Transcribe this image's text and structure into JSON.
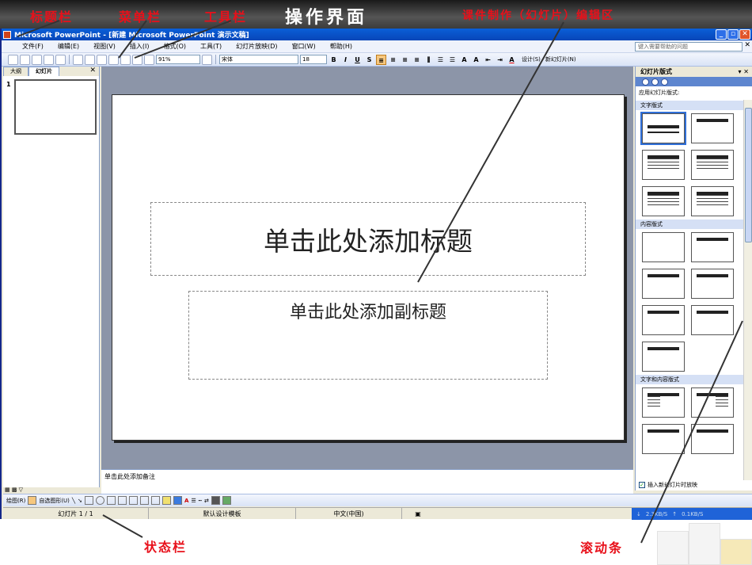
{
  "annotations": {
    "title_bar": "标题栏",
    "menu_bar": "菜单栏",
    "toolbar": "工具栏",
    "interface": "操作界面",
    "edit_area": "课件制作（幻灯片）编辑区",
    "status_bar": "状态栏",
    "scrollbar": "滚动条"
  },
  "window": {
    "title": "Microsoft PowerPoint - [新建 Microsoft PowerPoint 演示文稿]"
  },
  "menu": {
    "items": [
      "文件(F)",
      "编辑(E)",
      "视图(V)",
      "插入(I)",
      "格式(O)",
      "工具(T)",
      "幻灯片放映(D)",
      "窗口(W)",
      "帮助(H)"
    ],
    "help_placeholder": "键入需要帮助的问题"
  },
  "toolbar": {
    "zoom": "91%",
    "font": "宋体",
    "font_size": "18",
    "format_buttons": [
      "B",
      "I",
      "U",
      "S"
    ],
    "design_label": "设计(S)",
    "new_slide_label": "新幻灯片(N)"
  },
  "left_pane": {
    "tabs": [
      "大纲",
      "幻灯片"
    ],
    "slide_number": "1"
  },
  "slide": {
    "title_placeholder": "单击此处添加标题",
    "subtitle_placeholder": "单击此处添加副标题"
  },
  "notes": {
    "placeholder": "单击此处添加备注"
  },
  "task_pane": {
    "title": "幻灯片版式",
    "apply_label": "应用幻灯片版式:",
    "sections": [
      "文字版式",
      "内容版式",
      "文字和内容版式"
    ],
    "footer_label": "插入新幻灯片时放映"
  },
  "draw_toolbar": {
    "draw_label": "绘图(R)",
    "autoshape_label": "自选图形(U)"
  },
  "status": {
    "slide_count": "幻灯片 1 / 1",
    "template": "默认设计模板",
    "language": "中文(中国)",
    "net_down": "2.3KB/S",
    "net_up": "0.1KB/S"
  },
  "colors": {
    "annotation": "#e8101a",
    "titlebar": "#0a5fd8",
    "workspace": "#8c95a8"
  }
}
